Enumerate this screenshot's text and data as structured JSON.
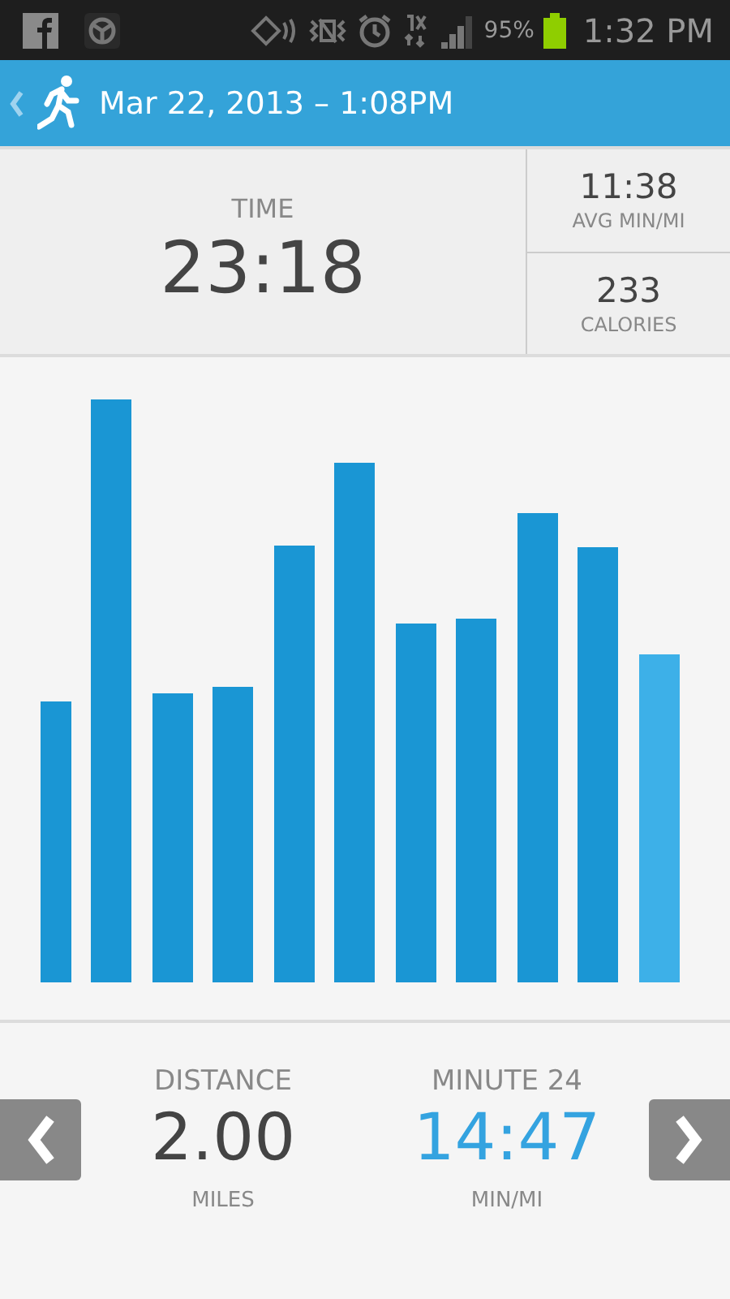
{
  "status_bar": {
    "battery": "95%",
    "time": "1:32 PM"
  },
  "header": {
    "title": "Mar 22, 2013 – 1:08PM"
  },
  "summary": {
    "time": {
      "label": "TIME",
      "value": "23:18"
    },
    "pace": {
      "value": "11:38",
      "label": "AVG MIN/MI"
    },
    "calories": {
      "value": "233",
      "label": "CALORIES"
    }
  },
  "footer": {
    "distance": {
      "label": "DISTANCE",
      "value": "2.00",
      "unit": "MILES"
    },
    "minute": {
      "label": "MINUTE 24",
      "value": "14:47",
      "unit": "MIN/MI"
    }
  }
}
